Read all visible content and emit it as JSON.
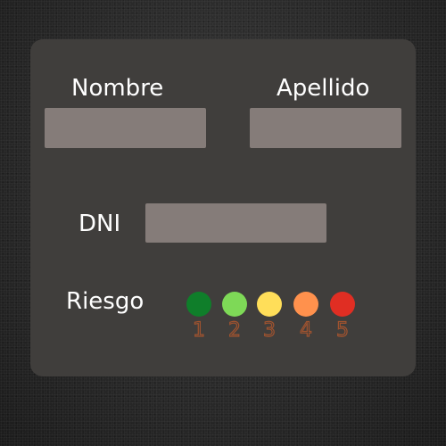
{
  "form": {
    "nombre_label": "Nombre",
    "nombre_value": "",
    "apellido_label": "Apellido",
    "apellido_value": "",
    "dni_label": "DNI",
    "dni_value": "",
    "riesgo_label": "Riesgo"
  },
  "risk_levels": [
    {
      "number": "1",
      "color": "#0f7e2a"
    },
    {
      "number": "2",
      "color": "#7ed957"
    },
    {
      "number": "3",
      "color": "#ffde59"
    },
    {
      "number": "4",
      "color": "#ff914d"
    },
    {
      "number": "5",
      "color": "#e02e23"
    }
  ],
  "colors": {
    "card_background": "#403e3c",
    "field_background": "#857c79",
    "number_outline": "#a0532f"
  }
}
